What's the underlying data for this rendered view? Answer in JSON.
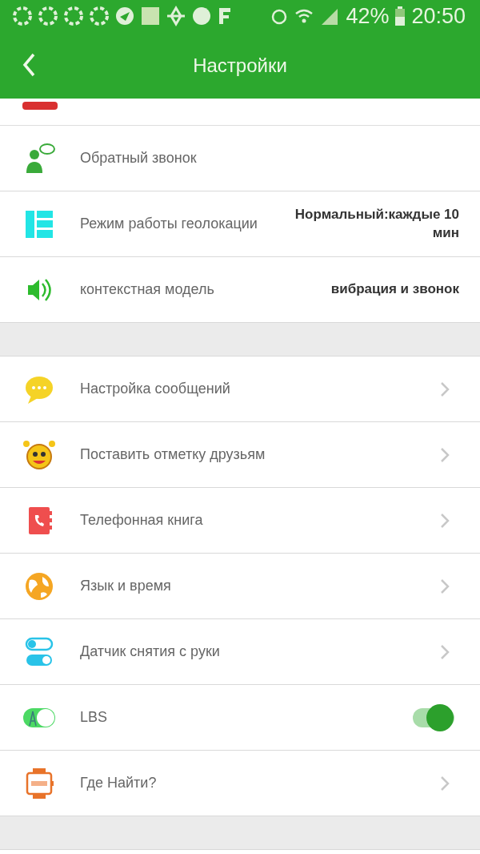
{
  "status_bar": {
    "battery": "42%",
    "time": "20:50"
  },
  "header": {
    "title": "Настройки"
  },
  "sections": [
    {
      "items": [
        {
          "kind": "plain",
          "label": "Обратный звонок"
        },
        {
          "kind": "value",
          "label": "Режим работы геолокации",
          "value": "Нормальный:каждые 10 мин"
        },
        {
          "kind": "value",
          "label": "контекстная модель",
          "value": "вибрация и звонок"
        }
      ]
    },
    {
      "items": [
        {
          "kind": "link",
          "label": "Настройка сообщений"
        },
        {
          "kind": "link",
          "label": "Поставить отметку друзьям"
        },
        {
          "kind": "link",
          "label": "Телефонная книга"
        },
        {
          "kind": "link",
          "label": "Язык и время"
        },
        {
          "kind": "link",
          "label": "Датчик снятия с руки"
        },
        {
          "kind": "toggle",
          "label": "LBS",
          "on": true
        },
        {
          "kind": "link",
          "label": "Где Найти?"
        }
      ]
    }
  ]
}
